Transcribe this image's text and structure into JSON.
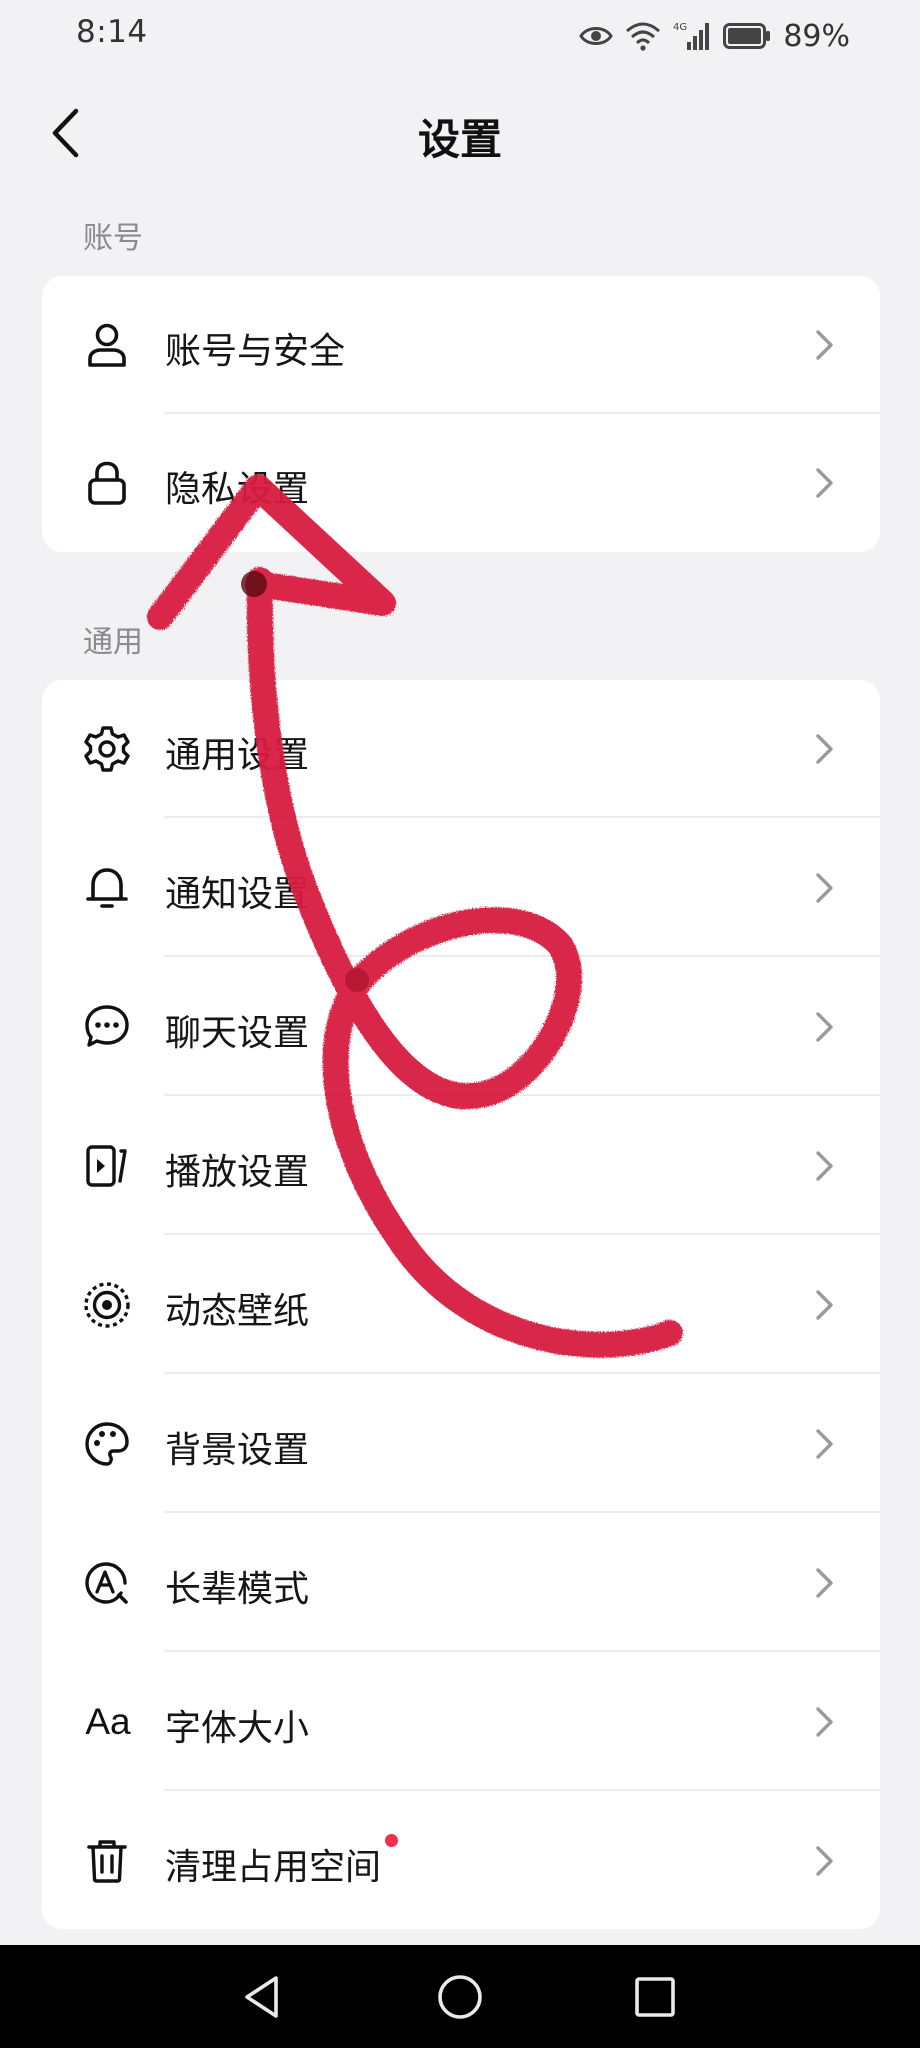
{
  "status_bar": {
    "time": "8:14",
    "battery": "89%",
    "network": "4G",
    "icons": [
      "eye-icon",
      "wifi-icon",
      "signal-icon",
      "battery-icon"
    ]
  },
  "header": {
    "title": "设置",
    "back_icon": "chevron-left-icon"
  },
  "sections": {
    "account": {
      "label": "账号",
      "items": [
        {
          "label": "账号与安全",
          "icon": "user-icon"
        },
        {
          "label": "隐私设置",
          "icon": "lock-icon"
        }
      ]
    },
    "general": {
      "label": "通用",
      "items": [
        {
          "label": "通用设置",
          "icon": "gear-icon"
        },
        {
          "label": "通知设置",
          "icon": "bell-icon"
        },
        {
          "label": "聊天设置",
          "icon": "chat-bubble-icon"
        },
        {
          "label": "播放设置",
          "icon": "play-screen-icon"
        },
        {
          "label": "动态壁纸",
          "icon": "live-wallpaper-icon"
        },
        {
          "label": "背景设置",
          "icon": "palette-icon"
        },
        {
          "label": "长辈模式",
          "icon": "elder-mode-icon"
        },
        {
          "label": "字体大小",
          "icon": "font-size-icon",
          "icon_text": "Aa"
        },
        {
          "label": "清理占用空间",
          "icon": "trash-icon",
          "badge": "red-dot"
        }
      ]
    }
  },
  "annotation": {
    "type": "hand-drawn red arrow",
    "color": "#d81e40"
  },
  "system_nav": {
    "buttons": [
      "back-triangle-icon",
      "home-circle-icon",
      "recents-square-icon"
    ]
  },
  "colors": {
    "background": "#f2f2f4",
    "card": "#ffffff",
    "section_label": "#8a8a8f",
    "badge": "#f0304e"
  }
}
